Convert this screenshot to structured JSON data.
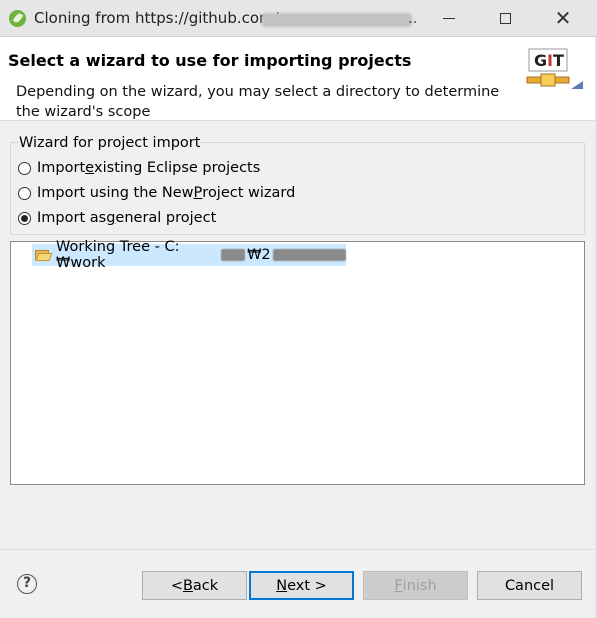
{
  "window": {
    "title": "Cloning from https://github.com/",
    "title_ellipsis": ".."
  },
  "header": {
    "title": "Select a wizard to use for importing projects",
    "description": "Depending on the wizard, you may select a directory to determine the wizard's scope",
    "icon": "git-icon",
    "icon_text": "GIT"
  },
  "wizard_group": {
    "label": "Wizard for project import",
    "options": [
      {
        "pre": "Import ",
        "mnemonic": "e",
        "post": "xisting Eclipse projects",
        "checked": false
      },
      {
        "pre": "Import using the New ",
        "mnemonic": "P",
        "post": "roject wizard",
        "checked": false
      },
      {
        "pre": "Import as ",
        "mnemonic": "g",
        "post": "eneral project",
        "checked": true
      }
    ]
  },
  "tree": {
    "items": [
      {
        "label_prefix": "Working Tree - C:₩work",
        "label_mid": "₩2",
        "icon": "folder-open-icon",
        "selected": true
      }
    ]
  },
  "buttons": {
    "back": {
      "pre": "< ",
      "mnemonic": "B",
      "post": "ack",
      "enabled": true
    },
    "next": {
      "pre": "",
      "mnemonic": "N",
      "post": "ext >",
      "enabled": true,
      "default": true
    },
    "finish": {
      "pre": "",
      "mnemonic": "F",
      "post": "inish",
      "enabled": false
    },
    "cancel": {
      "pre": "",
      "mnemonic": "",
      "post": "Cancel",
      "enabled": true
    }
  },
  "help": {
    "glyph": "?"
  },
  "colors": {
    "selection": "#cce8ff",
    "default_button_border": "#0078d7",
    "spring_green": "#6db33f"
  }
}
